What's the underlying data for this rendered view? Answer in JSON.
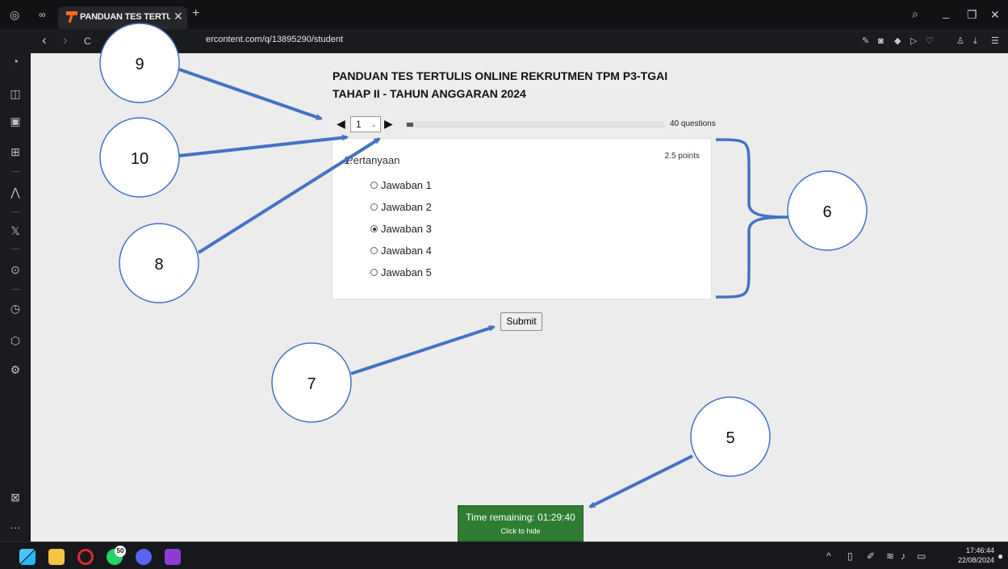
{
  "browser": {
    "tab_title": "PANDUAN TES TERTULIS O",
    "tab_close": "✕",
    "new_tab": "+",
    "url": "ercontent.com/q/13895290/student",
    "nav_back": "‹",
    "nav_forward": "›",
    "reload": "C",
    "window_search": "⌕",
    "window_minimize": "_",
    "window_restore": "❐",
    "window_close": "✕"
  },
  "quiz": {
    "title_line1": "PANDUAN TES TERTULIS ONLINE REKRUTMEN TPM P3-TGAI",
    "title_line2": "TAHAP II - TAHUN ANGGARAN 2024",
    "prev_arrow": "◀",
    "next_arrow": "▶",
    "current_question": "1",
    "total_questions_label": "40 questions",
    "progress_fraction": 0.025,
    "question": {
      "number": "1.",
      "text": "Pertanyaan",
      "points": "2.5 points",
      "options": [
        "Jawaban 1",
        "Jawaban 2",
        "Jawaban 3",
        "Jawaban 4",
        "Jawaban 5"
      ],
      "selected_index": 2
    },
    "submit_label": "Submit",
    "timer": {
      "text": "Time remaining: 01:29:40",
      "hide_label": "Click to hide",
      "color": "#2e7d32"
    }
  },
  "annotations": {
    "callouts": [
      "9",
      "10",
      "8",
      "7",
      "6",
      "5"
    ],
    "color": "#4472c4"
  },
  "taskbar": {
    "whatsapp_badge": "50",
    "time": "17:46:44",
    "date": "22/08/2024"
  }
}
